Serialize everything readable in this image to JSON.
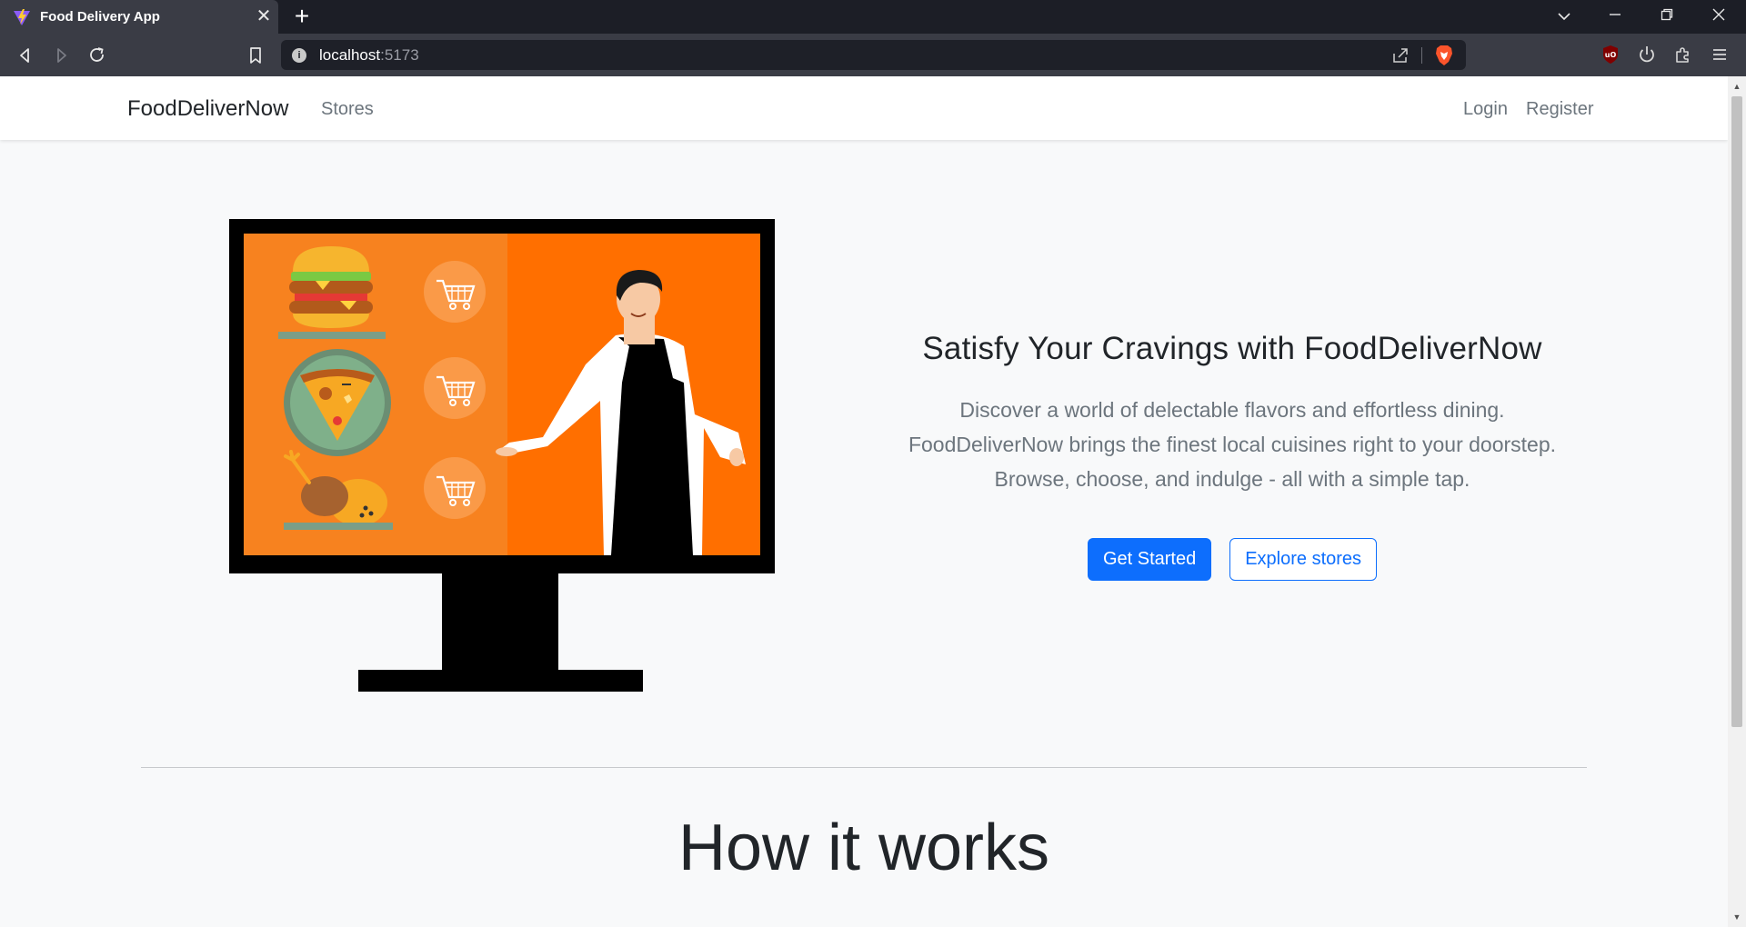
{
  "browser": {
    "tab_title": "Food Delivery App",
    "url_host": "localhost",
    "url_port": ":5173"
  },
  "navbar": {
    "brand": "FoodDeliverNow",
    "links": [
      "Stores"
    ],
    "auth": [
      "Login",
      "Register"
    ]
  },
  "hero": {
    "title": "Satisfy Your Cravings with FoodDeliverNow",
    "lead_lines": [
      "Discover a world of delectable flavors and effortless dining.",
      "FoodDeliverNow brings the finest local cuisines right to your doorstep.",
      "Browse, choose, and indulge - all with a simple tap."
    ],
    "primary_button": "Get Started",
    "secondary_button": "Explore stores"
  },
  "how_it_works": {
    "title": "How it works"
  },
  "colors": {
    "primary": "#0d6efd",
    "illustration_orange": "#ff6f00",
    "illustration_panel": "#f7821f"
  }
}
